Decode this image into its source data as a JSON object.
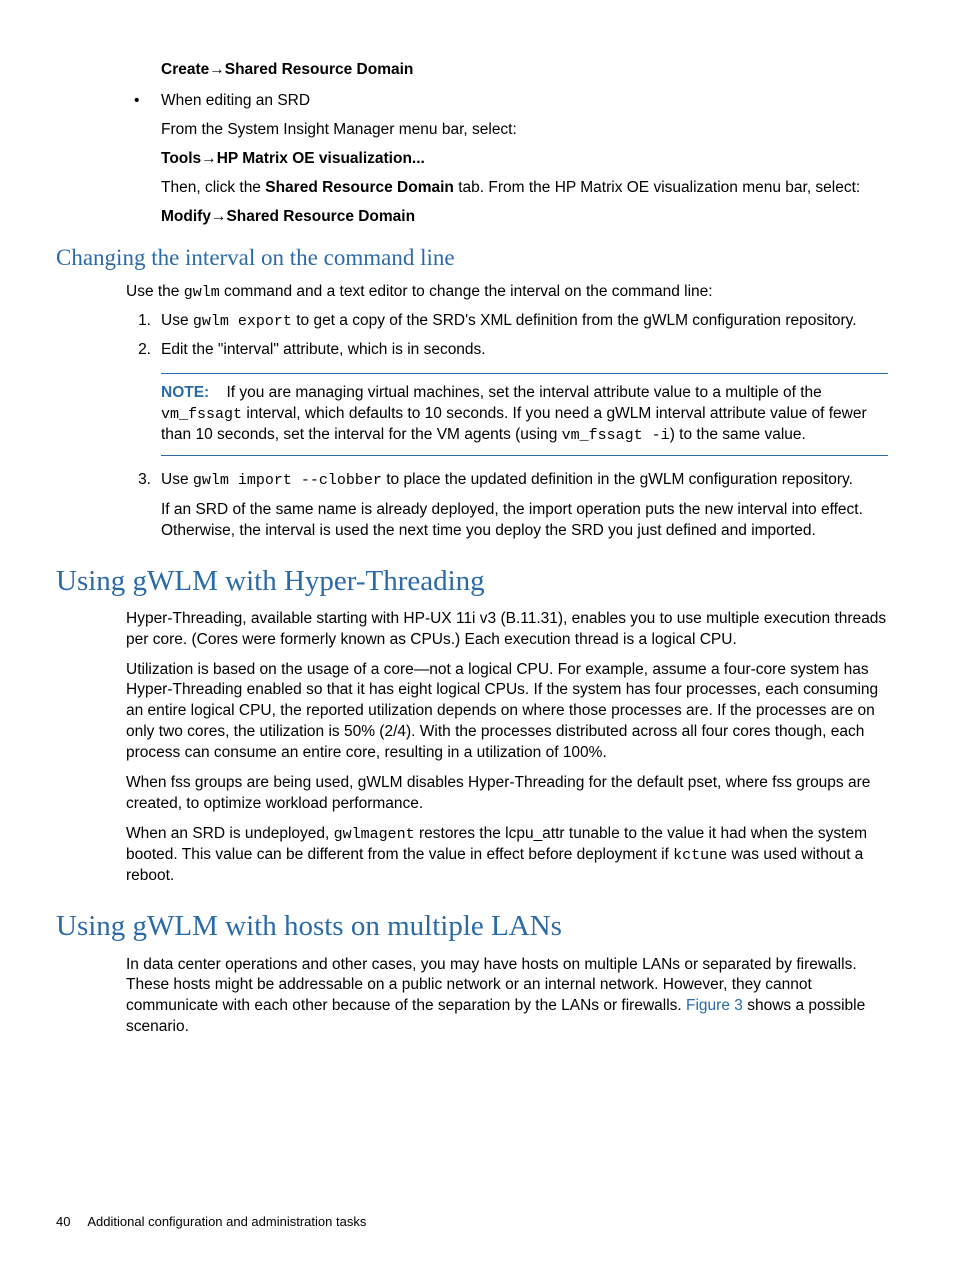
{
  "menu1": {
    "prefix": "Create",
    "arrow": "→",
    "suffix": "Shared Resource Domain"
  },
  "bullet_edit": "When editing an SRD",
  "bullet_edit_p1": "From the System Insight Manager menu bar, select:",
  "menu2": {
    "prefix": "Tools",
    "arrow": "→",
    "suffix": "HP Matrix OE visualization..."
  },
  "bullet_edit_p2a": "Then, click the ",
  "bullet_edit_p2b": "Shared Resource Domain",
  "bullet_edit_p2c": " tab. From the HP Matrix OE visualization menu bar, select:",
  "menu3": {
    "prefix": "Modify",
    "arrow": "→",
    "suffix": "Shared Resource Domain"
  },
  "h2_changing": "Changing the interval on the command line",
  "changing_intro_a": "Use the ",
  "changing_intro_cmd": "gwlm",
  "changing_intro_b": " command and a text editor to change the interval on the command line:",
  "step1": {
    "num": "1.",
    "a": "Use ",
    "cmd": "gwlm export",
    "b": " to get a copy of the SRD's XML definition from the gWLM configuration repository."
  },
  "step2": {
    "num": "2.",
    "text": "Edit the \"interval\" attribute, which is in seconds."
  },
  "note": {
    "label": "NOTE:",
    "a": "If you are managing virtual machines, set the interval attribute value to a multiple of the ",
    "cmd1": "vm_fssagt",
    "b": " interval, which defaults to 10 seconds. If you need a gWLM interval attribute value of fewer than 10 seconds, set the interval for the VM agents (using ",
    "cmd2": "vm_fssagt -i",
    "c": ") to the same value."
  },
  "step3": {
    "num": "3.",
    "a": "Use ",
    "cmd": "gwlm import --clobber",
    "b": " to place the updated definition in the gWLM configuration repository.",
    "p2": "If an SRD of the same name is already deployed, the import operation puts the new interval into effect. Otherwise, the interval is used the next time you deploy the SRD you just defined and imported."
  },
  "h1_hyper": "Using gWLM with Hyper-Threading",
  "hyper_p1": "Hyper-Threading, available starting with HP-UX 11i v3 (B.11.31), enables you to use multiple execution threads per core. (Cores were formerly known as CPUs.) Each execution thread is a logical CPU.",
  "hyper_p2": "Utilization is based on the usage of a core—not a logical CPU. For example, assume a four-core system has Hyper-Threading enabled so that it has eight logical CPUs. If the system has four processes, each consuming an entire logical CPU, the reported utilization depends on where those processes are. If the processes are on only two cores, the utilization is 50% (2/4). With the processes distributed across all four cores though, each process can consume an entire core, resulting in a utilization of 100%.",
  "hyper_p3": "When fss groups are being used, gWLM disables Hyper-Threading for the default pset, where fss groups are created, to optimize workload performance.",
  "hyper_p4a": "When an SRD is undeployed, ",
  "hyper_p4_cmd1": "gwlmagent",
  "hyper_p4b": " restores the lcpu_attr tunable to the value it had when the system booted. This value can be different from the value in effect before deployment if ",
  "hyper_p4_cmd2": "kctune",
  "hyper_p4c": " was used without a reboot.",
  "h1_lans": "Using gWLM with hosts on multiple LANs",
  "lans_p1a": "In data center operations and other cases, you may have hosts on multiple LANs or separated by firewalls. These hosts might be addressable on a public network or an internal network. However, they cannot communicate with each other because of the separation by the LANs or firewalls. ",
  "lans_link": "Figure 3",
  "lans_p1b": " shows a possible scenario.",
  "footer_page": "40",
  "footer_text": "Additional configuration and administration tasks"
}
